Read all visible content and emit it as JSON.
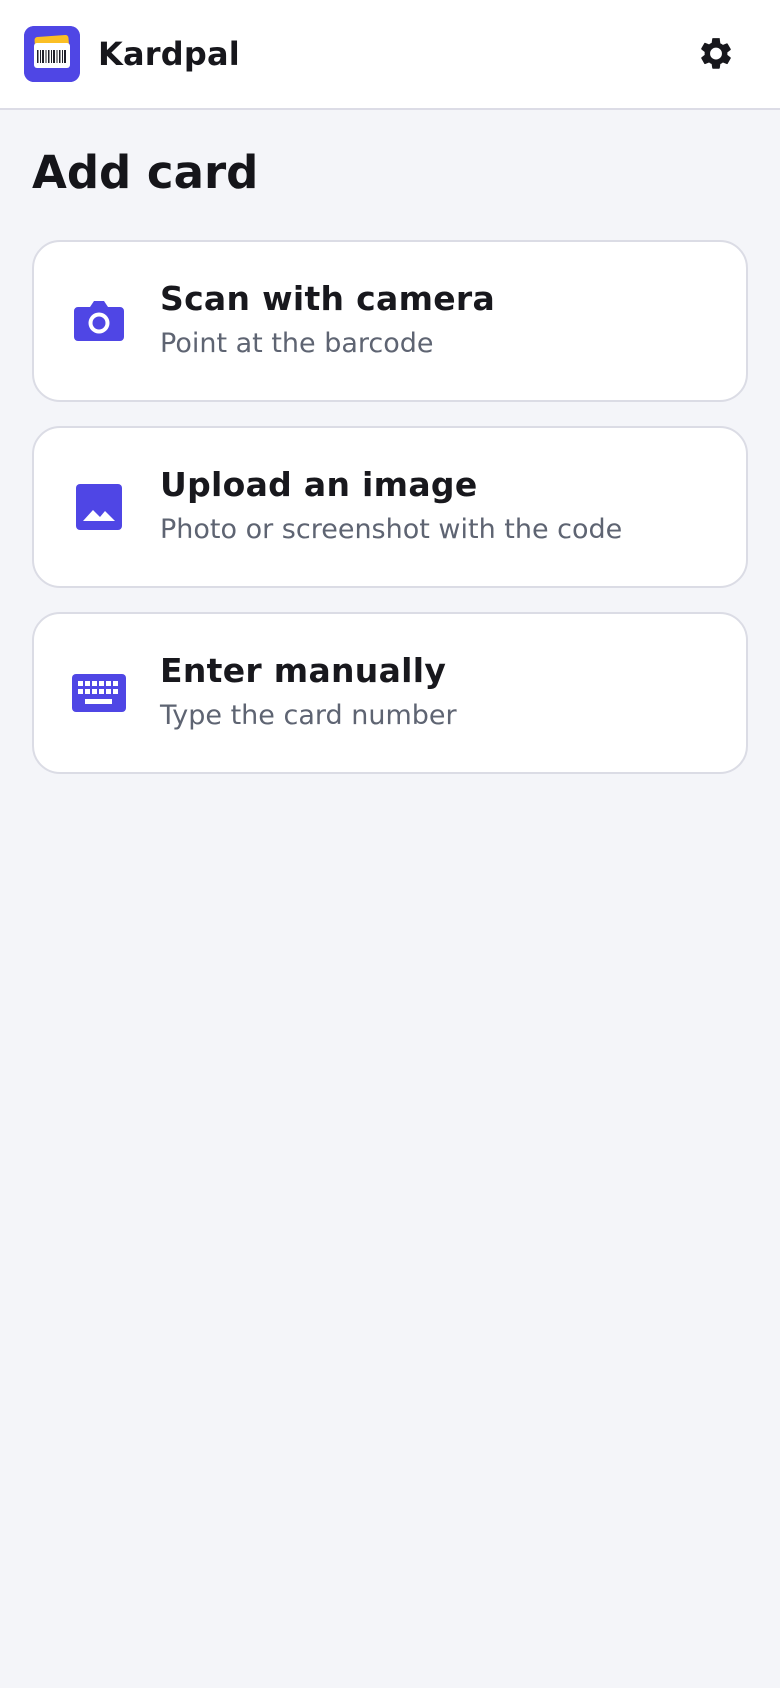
{
  "app": {
    "name": "Kardpal",
    "accent_color": "#4f46e5",
    "logo_icon": "barcode-card-icon"
  },
  "header": {
    "settings_icon": "gear-icon"
  },
  "page": {
    "title": "Add card"
  },
  "options": [
    {
      "icon": "camera-icon",
      "title": "Scan with camera",
      "subtitle": "Point at the barcode"
    },
    {
      "icon": "image-icon",
      "title": "Upload an image",
      "subtitle": "Photo or screenshot with the code"
    },
    {
      "icon": "keyboard-icon",
      "title": "Enter manually",
      "subtitle": "Type the card number"
    }
  ]
}
